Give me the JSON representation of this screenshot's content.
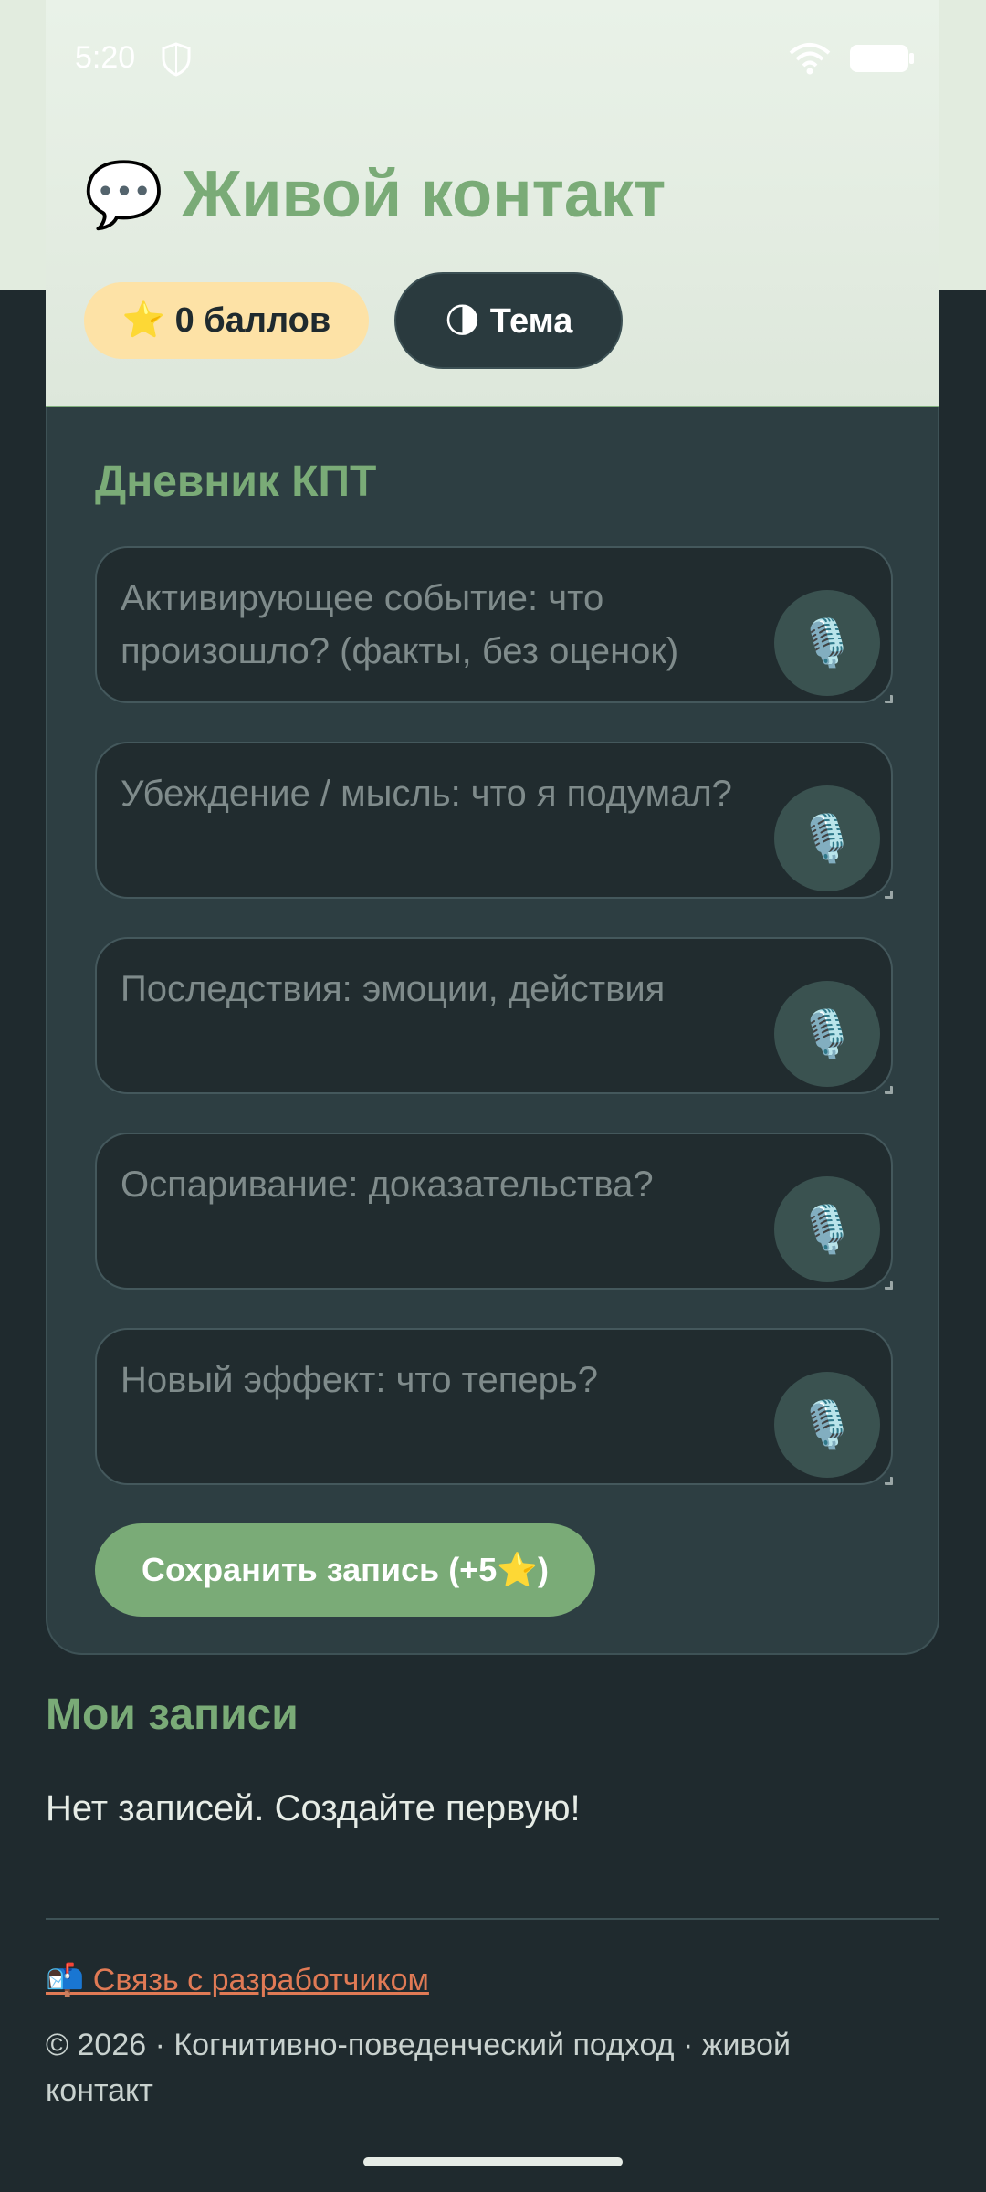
{
  "status_bar": {
    "time": "5:20",
    "icons": [
      "shield-icon",
      "wifi-icon",
      "battery-icon"
    ]
  },
  "header": {
    "title_icon": "💬",
    "title": "Живой контакт",
    "points_badge": "⭐ 0 баллов",
    "theme_button": "🌗 Тема"
  },
  "diary": {
    "title": "Дневник КПТ",
    "fields": [
      {
        "placeholder": "Активирующее событие: что произошло? (факты, без оценок)",
        "mic": "🎙️"
      },
      {
        "placeholder": "Убеждение / мысль: что я подумал?",
        "mic": "🎙️"
      },
      {
        "placeholder": "Последствия: эмоции, действия",
        "mic": "🎙️"
      },
      {
        "placeholder": "Оспаривание: доказательства?",
        "mic": "🎙️"
      },
      {
        "placeholder": "Новый эффект: что теперь?",
        "mic": "🎙️"
      }
    ],
    "save_button": "Сохранить запись (+5⭐)"
  },
  "records": {
    "title": "Мои записи",
    "empty_text": "Нет записей. Создайте первую!"
  },
  "footer": {
    "contact_link": "📬 Связь с разработчиком",
    "copyright": "© 2026 · Когнитивно-поведенческий подход · живой контакт"
  },
  "colors": {
    "accent": "#7aab77",
    "background": "#1f2a2e",
    "card": "#2d3e42",
    "badge": "#fde2a6",
    "link": "#e07a55"
  }
}
